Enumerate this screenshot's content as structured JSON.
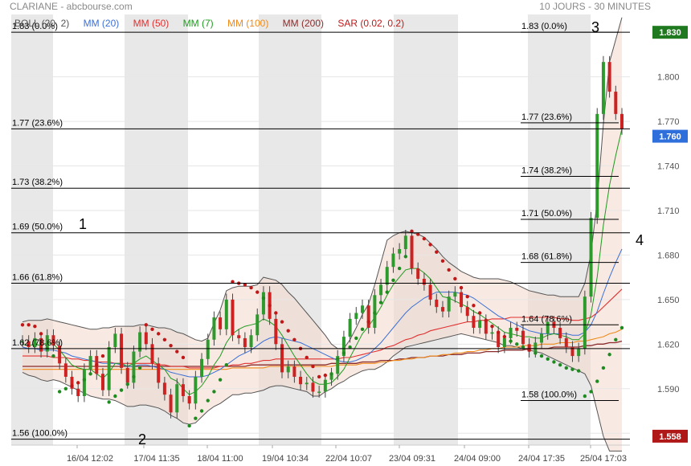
{
  "header": {
    "left": "CLARIANE - abcbourse.com",
    "right": "10 JOURS - 30 MINUTES"
  },
  "legend": [
    {
      "label": "BOLL (20, 2)",
      "color": "#555555"
    },
    {
      "label": "MM (20)",
      "color": "#3b6fd6"
    },
    {
      "label": "MM (50)",
      "color": "#e03030"
    },
    {
      "label": "MM (7)",
      "color": "#1f9a1f"
    },
    {
      "label": "MM (100)",
      "color": "#f08a1a"
    },
    {
      "label": "MM (200)",
      "color": "#8b2a2a"
    },
    {
      "label": "SAR (0.02, 0.2)",
      "color": "#c01818"
    }
  ],
  "price_badges": {
    "high": "1.830",
    "current": "1.760",
    "low": "1.558"
  },
  "annotations": [
    "1",
    "2",
    "3",
    "4"
  ],
  "chart_data": {
    "type": "line",
    "title": "",
    "xlabel": "",
    "ylabel": "",
    "ylim": [
      1.552,
      1.842
    ],
    "y_ticks": [
      "1.800",
      "1.770",
      "1.740",
      "1.710",
      "1.680",
      "1.650",
      "1.620",
      "1.590",
      "1.560"
    ],
    "x_ticks": [
      "16/04 12:02",
      "17/04 11:35",
      "18/04 11:00",
      "19/04 10:34",
      "22/04 10:07",
      "23/04 09:31",
      "24/04 09:00",
      "24/04 17:35",
      "25/04 17:03"
    ],
    "fib_left": [
      {
        "label": "1.83  (0.0%)",
        "value": 1.83
      },
      {
        "label": "1.77  (23.6%)",
        "value": 1.765
      },
      {
        "label": "1.73  (38.2%)",
        "value": 1.725
      },
      {
        "label": "1.69  (50.0%)",
        "value": 1.695
      },
      {
        "label": "1.66  (61.8%)",
        "value": 1.661
      },
      {
        "label": "1.62  (78.6%)",
        "value": 1.617
      },
      {
        "label": "1.56  (100.0%)",
        "value": 1.556
      }
    ],
    "fib_right": [
      {
        "label": "1.83  (0.0%)",
        "value": 1.83
      },
      {
        "label": "1.77  (23.6%)",
        "value": 1.769
      },
      {
        "label": "1.74  (38.2%)",
        "value": 1.733
      },
      {
        "label": "1.71  (50.0%)",
        "value": 1.704
      },
      {
        "label": "1.68  (61.8%)",
        "value": 1.675
      },
      {
        "label": "1.64  (78.6%)",
        "value": 1.633
      },
      {
        "label": "1.58  (100.0%)",
        "value": 1.582
      }
    ],
    "series": [
      {
        "name": "Close",
        "values": [
          1.622,
          1.618,
          1.624,
          1.615,
          1.626,
          1.619,
          1.607,
          1.598,
          1.59,
          1.585,
          1.603,
          1.612,
          1.6,
          1.589,
          1.618,
          1.627,
          1.604,
          1.594,
          1.615,
          1.628,
          1.62,
          1.607,
          1.594,
          1.586,
          1.574,
          1.593,
          1.585,
          1.58,
          1.598,
          1.61,
          1.623,
          1.638,
          1.63,
          1.65,
          1.626,
          1.624,
          1.618,
          1.626,
          1.64,
          1.655,
          1.637,
          1.62,
          1.601,
          1.605,
          1.598,
          1.593,
          1.594,
          1.588,
          1.588,
          1.596,
          1.6,
          1.612,
          1.625,
          1.637,
          1.641,
          1.646,
          1.631,
          1.653,
          1.66,
          1.672,
          1.681,
          1.684,
          1.693,
          1.671,
          1.664,
          1.66,
          1.65,
          1.645,
          1.642,
          1.652,
          1.655,
          1.645,
          1.639,
          1.631,
          1.636,
          1.627,
          1.628,
          1.618,
          1.624,
          1.631,
          1.629,
          1.62,
          1.615,
          1.621,
          1.627,
          1.635,
          1.631,
          1.624,
          1.618,
          1.612,
          1.617,
          1.652,
          1.705,
          1.775,
          1.81,
          1.79,
          1.775,
          1.765
        ]
      },
      {
        "name": "MM (7)",
        "values": [
          1.62,
          1.619,
          1.62,
          1.619,
          1.621,
          1.62,
          1.616,
          1.611,
          1.606,
          1.604,
          1.603,
          1.603,
          1.6,
          1.597,
          1.601,
          1.607,
          1.607,
          1.605,
          1.607,
          1.61,
          1.612,
          1.609,
          1.606,
          1.603,
          1.597,
          1.595,
          1.59,
          1.586,
          1.588,
          1.592,
          1.598,
          1.606,
          1.612,
          1.621,
          1.627,
          1.63,
          1.632,
          1.633,
          1.634,
          1.637,
          1.635,
          1.632,
          1.626,
          1.619,
          1.612,
          1.606,
          1.6,
          1.595,
          1.593,
          1.593,
          1.594,
          1.598,
          1.603,
          1.611,
          1.619,
          1.627,
          1.632,
          1.638,
          1.645,
          1.653,
          1.66,
          1.665,
          1.67,
          1.671,
          1.671,
          1.668,
          1.664,
          1.658,
          1.652,
          1.651,
          1.649,
          1.647,
          1.645,
          1.642,
          1.64,
          1.637,
          1.634,
          1.631,
          1.628,
          1.627,
          1.626,
          1.625,
          1.625,
          1.624,
          1.624,
          1.626,
          1.627,
          1.626,
          1.625,
          1.623,
          1.623,
          1.627,
          1.64,
          1.665,
          1.7,
          1.727,
          1.747,
          1.765
        ]
      },
      {
        "name": "MM (20)",
        "values": [
          1.618,
          1.617,
          1.617,
          1.616,
          1.616,
          1.616,
          1.615,
          1.614,
          1.612,
          1.611,
          1.61,
          1.609,
          1.608,
          1.607,
          1.607,
          1.607,
          1.606,
          1.605,
          1.605,
          1.606,
          1.606,
          1.605,
          1.604,
          1.603,
          1.601,
          1.6,
          1.599,
          1.598,
          1.598,
          1.598,
          1.599,
          1.601,
          1.603,
          1.606,
          1.609,
          1.612,
          1.614,
          1.616,
          1.619,
          1.622,
          1.624,
          1.625,
          1.624,
          1.623,
          1.622,
          1.621,
          1.619,
          1.617,
          1.615,
          1.613,
          1.611,
          1.609,
          1.608,
          1.608,
          1.609,
          1.611,
          1.613,
          1.617,
          1.621,
          1.626,
          1.631,
          1.636,
          1.641,
          1.645,
          1.648,
          1.651,
          1.653,
          1.655,
          1.655,
          1.655,
          1.655,
          1.654,
          1.653,
          1.651,
          1.648,
          1.645,
          1.642,
          1.639,
          1.637,
          1.635,
          1.633,
          1.631,
          1.629,
          1.628,
          1.627,
          1.627,
          1.627,
          1.627,
          1.627,
          1.626,
          1.626,
          1.628,
          1.633,
          1.642,
          1.654,
          1.665,
          1.675,
          1.684
        ]
      },
      {
        "name": "MM (50)",
        "values": [
          1.612,
          1.612,
          1.612,
          1.612,
          1.612,
          1.611,
          1.611,
          1.611,
          1.61,
          1.61,
          1.609,
          1.609,
          1.608,
          1.608,
          1.608,
          1.607,
          1.607,
          1.607,
          1.607,
          1.607,
          1.607,
          1.607,
          1.606,
          1.606,
          1.605,
          1.605,
          1.605,
          1.604,
          1.604,
          1.604,
          1.604,
          1.604,
          1.605,
          1.605,
          1.606,
          1.606,
          1.607,
          1.607,
          1.608,
          1.609,
          1.609,
          1.61,
          1.61,
          1.61,
          1.61,
          1.61,
          1.61,
          1.61,
          1.61,
          1.61,
          1.61,
          1.61,
          1.611,
          1.611,
          1.612,
          1.613,
          1.614,
          1.615,
          1.616,
          1.618,
          1.619,
          1.621,
          1.623,
          1.624,
          1.626,
          1.627,
          1.629,
          1.63,
          1.631,
          1.632,
          1.633,
          1.634,
          1.635,
          1.635,
          1.636,
          1.636,
          1.637,
          1.637,
          1.637,
          1.638,
          1.638,
          1.638,
          1.638,
          1.638,
          1.638,
          1.638,
          1.638,
          1.637,
          1.637,
          1.636,
          1.636,
          1.637,
          1.638,
          1.641,
          1.645,
          1.649,
          1.653,
          1.657
        ]
      },
      {
        "name": "MM (100)",
        "values": [
          1.603,
          1.603,
          1.603,
          1.603,
          1.603,
          1.603,
          1.603,
          1.603,
          1.603,
          1.603,
          1.603,
          1.603,
          1.603,
          1.603,
          1.603,
          1.603,
          1.603,
          1.603,
          1.603,
          1.603,
          1.603,
          1.603,
          1.603,
          1.603,
          1.603,
          1.603,
          1.603,
          1.603,
          1.603,
          1.603,
          1.603,
          1.603,
          1.603,
          1.603,
          1.604,
          1.604,
          1.604,
          1.604,
          1.604,
          1.604,
          1.605,
          1.605,
          1.605,
          1.605,
          1.605,
          1.605,
          1.605,
          1.605,
          1.605,
          1.605,
          1.605,
          1.606,
          1.606,
          1.606,
          1.606,
          1.607,
          1.607,
          1.607,
          1.608,
          1.608,
          1.609,
          1.609,
          1.61,
          1.61,
          1.611,
          1.611,
          1.612,
          1.612,
          1.613,
          1.613,
          1.614,
          1.614,
          1.615,
          1.615,
          1.616,
          1.616,
          1.617,
          1.617,
          1.618,
          1.618,
          1.618,
          1.619,
          1.619,
          1.619,
          1.62,
          1.62,
          1.62,
          1.621,
          1.621,
          1.621,
          1.622,
          1.622,
          1.623,
          1.624,
          1.625,
          1.627,
          1.628,
          1.63
        ]
      },
      {
        "name": "MM (200)",
        "values": [
          1.605,
          1.605,
          1.605,
          1.605,
          1.605,
          1.605,
          1.605,
          1.605,
          1.605,
          1.605,
          1.605,
          1.605,
          1.605,
          1.605,
          1.605,
          1.605,
          1.605,
          1.605,
          1.605,
          1.605,
          1.605,
          1.605,
          1.605,
          1.605,
          1.605,
          1.605,
          1.605,
          1.605,
          1.605,
          1.605,
          1.605,
          1.605,
          1.605,
          1.605,
          1.605,
          1.605,
          1.605,
          1.606,
          1.606,
          1.606,
          1.606,
          1.606,
          1.606,
          1.606,
          1.606,
          1.606,
          1.606,
          1.606,
          1.606,
          1.606,
          1.607,
          1.607,
          1.607,
          1.607,
          1.607,
          1.608,
          1.608,
          1.608,
          1.609,
          1.609,
          1.609,
          1.61,
          1.61,
          1.611,
          1.611,
          1.611,
          1.612,
          1.612,
          1.612,
          1.613,
          1.613,
          1.613,
          1.614,
          1.614,
          1.614,
          1.615,
          1.615,
          1.615,
          1.616,
          1.616,
          1.616,
          1.616,
          1.617,
          1.617,
          1.617,
          1.617,
          1.618,
          1.618,
          1.618,
          1.618,
          1.618,
          1.619,
          1.619,
          1.62,
          1.62,
          1.621,
          1.621,
          1.622
        ]
      },
      {
        "name": "BOLL upper",
        "values": [
          1.635,
          1.636,
          1.636,
          1.636,
          1.637,
          1.636,
          1.635,
          1.634,
          1.633,
          1.632,
          1.631,
          1.63,
          1.63,
          1.631,
          1.631,
          1.632,
          1.632,
          1.632,
          1.632,
          1.633,
          1.633,
          1.632,
          1.631,
          1.631,
          1.63,
          1.628,
          1.627,
          1.625,
          1.623,
          1.622,
          1.624,
          1.634,
          1.643,
          1.656,
          1.658,
          1.659,
          1.659,
          1.659,
          1.66,
          1.665,
          1.664,
          1.663,
          1.66,
          1.655,
          1.651,
          1.646,
          1.641,
          1.636,
          1.631,
          1.626,
          1.62,
          1.617,
          1.617,
          1.623,
          1.631,
          1.64,
          1.647,
          1.66,
          1.675,
          1.69,
          1.693,
          1.695,
          1.696,
          1.695,
          1.694,
          1.692,
          1.688,
          1.684,
          1.679,
          1.675,
          1.672,
          1.669,
          1.667,
          1.665,
          1.664,
          1.664,
          1.664,
          1.664,
          1.663,
          1.662,
          1.66,
          1.658,
          1.656,
          1.655,
          1.654,
          1.653,
          1.653,
          1.652,
          1.652,
          1.652,
          1.652,
          1.661,
          1.681,
          1.716,
          1.768,
          1.81,
          1.825,
          1.84
        ]
      },
      {
        "name": "BOLL lower",
        "values": [
          1.601,
          1.599,
          1.598,
          1.596,
          1.595,
          1.596,
          1.595,
          1.593,
          1.591,
          1.589,
          1.587,
          1.585,
          1.584,
          1.583,
          1.583,
          1.582,
          1.58,
          1.578,
          1.578,
          1.579,
          1.579,
          1.578,
          1.577,
          1.575,
          1.572,
          1.57,
          1.567,
          1.566,
          1.567,
          1.571,
          1.575,
          1.578,
          1.58,
          1.583,
          1.586,
          1.586,
          1.587,
          1.587,
          1.588,
          1.589,
          1.591,
          1.592,
          1.592,
          1.591,
          1.59,
          1.589,
          1.588,
          1.585,
          1.585,
          1.588,
          1.59,
          1.593,
          1.595,
          1.598,
          1.6,
          1.602,
          1.603,
          1.603,
          1.605,
          1.608,
          1.612,
          1.615,
          1.618,
          1.619,
          1.62,
          1.621,
          1.622,
          1.623,
          1.624,
          1.625,
          1.626,
          1.627,
          1.626,
          1.625,
          1.624,
          1.623,
          1.622,
          1.621,
          1.619,
          1.619,
          1.618,
          1.617,
          1.616,
          1.615,
          1.614,
          1.612,
          1.61,
          1.608,
          1.606,
          1.604,
          1.602,
          1.6,
          1.592,
          1.575,
          1.558,
          1.548,
          1.548,
          1.548
        ]
      },
      {
        "name": "SAR",
        "values": [
          1.633,
          1.633,
          1.632,
          1.627,
          1.617,
          1.612,
          1.588,
          1.59,
          1.592,
          1.594,
          1.596,
          1.6,
          1.606,
          1.612,
          1.581,
          1.585,
          1.589,
          1.593,
          1.598,
          1.604,
          1.633,
          1.63,
          1.627,
          1.623,
          1.619,
          1.615,
          1.611,
          1.565,
          1.57,
          1.575,
          1.582,
          1.588,
          1.596,
          1.606,
          1.662,
          1.661,
          1.66,
          1.658,
          1.655,
          1.651,
          1.646,
          1.641,
          1.635,
          1.629,
          1.623,
          1.617,
          1.611,
          1.605,
          1.598,
          1.599,
          1.6,
          1.61,
          1.614,
          1.618,
          1.624,
          1.63,
          1.635,
          1.641,
          1.648,
          1.655,
          1.663,
          1.671,
          1.679,
          1.696,
          1.694,
          1.691,
          1.687,
          1.682,
          1.676,
          1.67,
          1.664,
          1.658,
          1.652,
          1.646,
          1.641,
          1.636,
          1.632,
          1.628,
          1.625,
          1.622,
          1.62,
          1.618,
          1.616,
          1.614,
          1.612,
          1.61,
          1.608,
          1.606,
          1.604,
          1.603,
          1.602,
          1.585,
          1.588,
          1.595,
          1.604,
          1.613,
          1.623,
          1.631
        ]
      }
    ]
  }
}
